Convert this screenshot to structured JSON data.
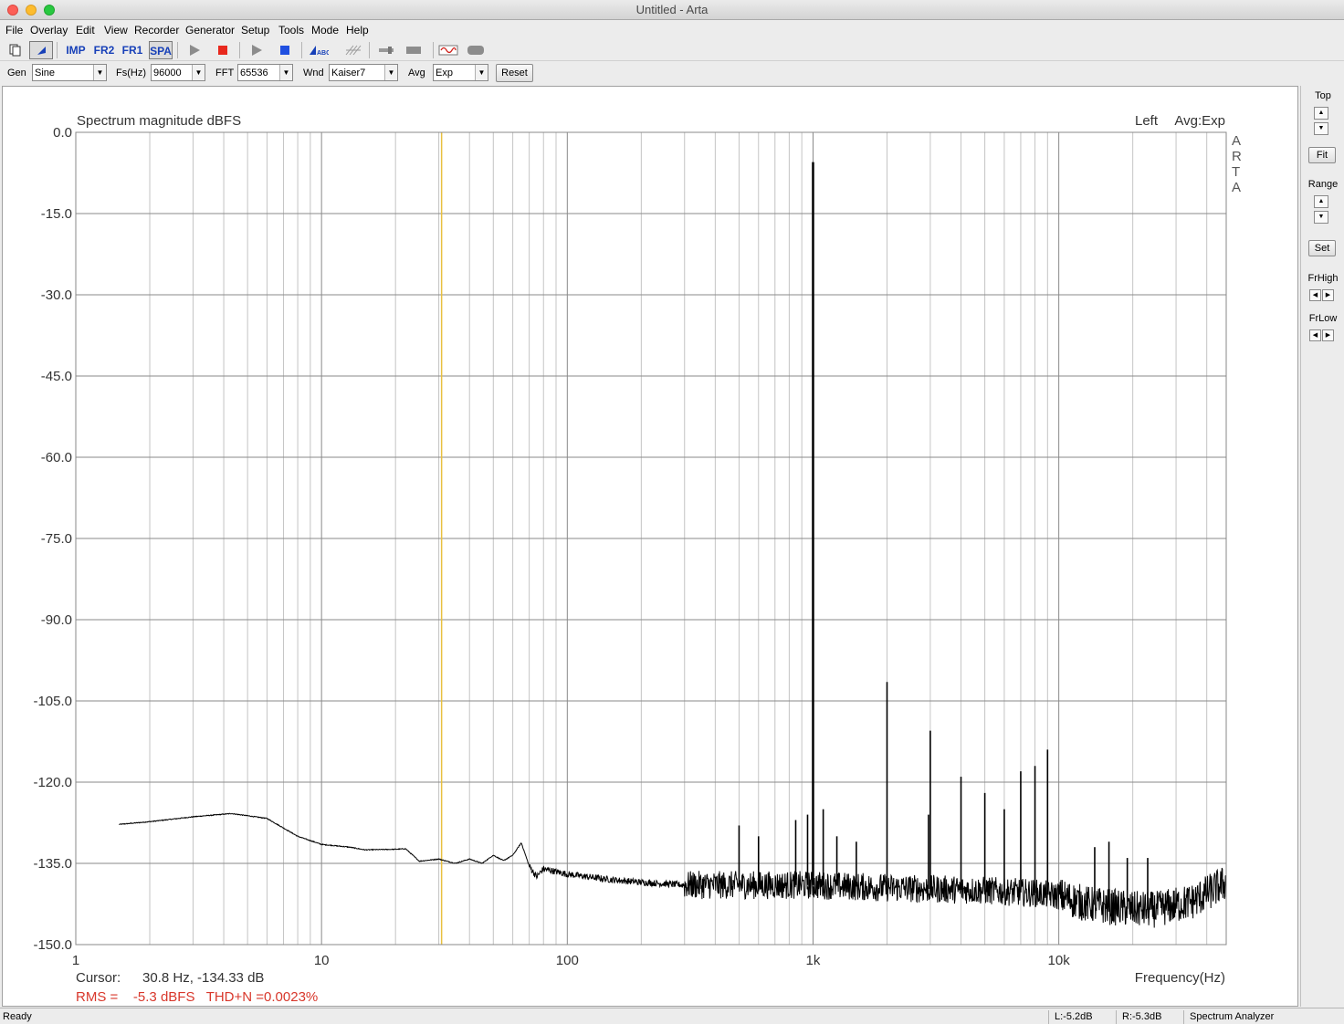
{
  "window": {
    "title": "Untitled - Arta"
  },
  "menu": [
    "File",
    "Overlay",
    "Edit",
    "View",
    "Recorder",
    "Generator",
    "Setup",
    "Tools",
    "Mode",
    "Help"
  ],
  "toolbar": {
    "buttons": [
      {
        "name": "new-doc-icon",
        "label": ""
      },
      {
        "name": "cursor-icon",
        "label": ""
      },
      {
        "name": "imp-button",
        "label": "IMP"
      },
      {
        "name": "fr2-button",
        "label": "FR2"
      },
      {
        "name": "fr1-button",
        "label": "FR1"
      },
      {
        "name": "spa-button",
        "label": "SPA"
      }
    ]
  },
  "controls": {
    "gen_label": "Gen",
    "gen_value": "Sine",
    "fs_label": "Fs(Hz)",
    "fs_value": "96000",
    "fft_label": "FFT",
    "fft_value": "65536",
    "wnd_label": "Wnd",
    "wnd_value": "Kaiser7",
    "avg_label": "Avg",
    "avg_value": "Exp",
    "reset_label": "Reset"
  },
  "side": {
    "top_label": "Top",
    "fit_label": "Fit",
    "range_label": "Range",
    "set_label": "Set",
    "frhigh_label": "FrHigh",
    "frlow_label": "FrLow"
  },
  "plot": {
    "channel": "Left",
    "avg": "Avg:Exp",
    "watermark": [
      "A",
      "R",
      "T",
      "A"
    ],
    "cursor_label": "Cursor:",
    "cursor_value": "30.8 Hz, -134.33 dB",
    "rms_text": "RMS =    -5.3 dBFS   THD+N =0.0023%",
    "cursor_freq_hz": 30.8
  },
  "chart_data": {
    "type": "line",
    "title": "Spectrum magnitude dBFS",
    "xlabel": "Frequency(Hz)",
    "ylabel": "",
    "xscale": "log",
    "xlim": [
      1,
      48000
    ],
    "ylim": [
      -150,
      0
    ],
    "grid": true,
    "yticks": [
      "0.0",
      "-15.0",
      "-30.0",
      "-45.0",
      "-60.0",
      "-75.0",
      "-90.0",
      "-105.0",
      "-120.0",
      "-135.0",
      "-150.0"
    ],
    "xticks": [
      {
        "value": 1,
        "label": "1"
      },
      {
        "value": 10,
        "label": "10"
      },
      {
        "value": 100,
        "label": "100"
      },
      {
        "value": 1000,
        "label": "1k"
      },
      {
        "value": 10000,
        "label": "10k"
      }
    ],
    "series": [
      {
        "color": "#000000",
        "noise_floor": [
          [
            1.5,
            -127.8
          ],
          [
            2,
            -127.3
          ],
          [
            3,
            -126.4
          ],
          [
            4.3,
            -125.8
          ],
          [
            6,
            -126.7
          ],
          [
            8,
            -130
          ],
          [
            10,
            -131.5
          ],
          [
            13,
            -132
          ],
          [
            15,
            -132.5
          ],
          [
            20,
            -132.4
          ],
          [
            22,
            -132.3
          ],
          [
            25,
            -134.6
          ],
          [
            30,
            -134.2
          ],
          [
            35,
            -135
          ],
          [
            40,
            -134.2
          ],
          [
            45,
            -135
          ],
          [
            50,
            -133.5
          ],
          [
            55,
            -134.5
          ],
          [
            60,
            -133.5
          ],
          [
            65,
            -131.2
          ],
          [
            70,
            -135.5
          ],
          [
            75,
            -137.5
          ],
          [
            80,
            -136
          ],
          [
            100,
            -137
          ],
          [
            150,
            -138
          ],
          [
            200,
            -138.5
          ],
          [
            300,
            -139
          ],
          [
            500,
            -139
          ],
          [
            1000,
            -139
          ],
          [
            2000,
            -139.5
          ],
          [
            5000,
            -140
          ],
          [
            8000,
            -140.5
          ],
          [
            10000,
            -141
          ],
          [
            13000,
            -142.5
          ],
          [
            20000,
            -143.5
          ],
          [
            25000,
            -143.5
          ],
          [
            35000,
            -142
          ],
          [
            42000,
            -140
          ],
          [
            48000,
            -138.5
          ]
        ],
        "peaks": [
          {
            "freq": 1000,
            "db": -5.5
          },
          {
            "freq": 2000,
            "db": -101.5
          },
          {
            "freq": 3000,
            "db": -110.5
          },
          {
            "freq": 4000,
            "db": -119
          },
          {
            "freq": 5000,
            "db": -122
          },
          {
            "freq": 6000,
            "db": -125
          },
          {
            "freq": 7000,
            "db": -118
          },
          {
            "freq": 8000,
            "db": -117
          },
          {
            "freq": 9000,
            "db": -114
          },
          {
            "freq": 500,
            "db": -128
          },
          {
            "freq": 600,
            "db": -130
          },
          {
            "freq": 850,
            "db": -127
          },
          {
            "freq": 950,
            "db": -126
          },
          {
            "freq": 1100,
            "db": -125
          },
          {
            "freq": 1250,
            "db": -130
          },
          {
            "freq": 1500,
            "db": -131
          },
          {
            "freq": 2950,
            "db": -126
          },
          {
            "freq": 14000,
            "db": -132
          },
          {
            "freq": 16000,
            "db": -131
          },
          {
            "freq": 19000,
            "db": -134
          },
          {
            "freq": 23000,
            "db": -134
          }
        ]
      }
    ],
    "cursor_color": "#e8c040"
  },
  "status": {
    "ready": "Ready",
    "left_level": "L:-5.2dB",
    "right_level": "R:-5.3dB",
    "mode": "Spectrum Analyzer"
  }
}
